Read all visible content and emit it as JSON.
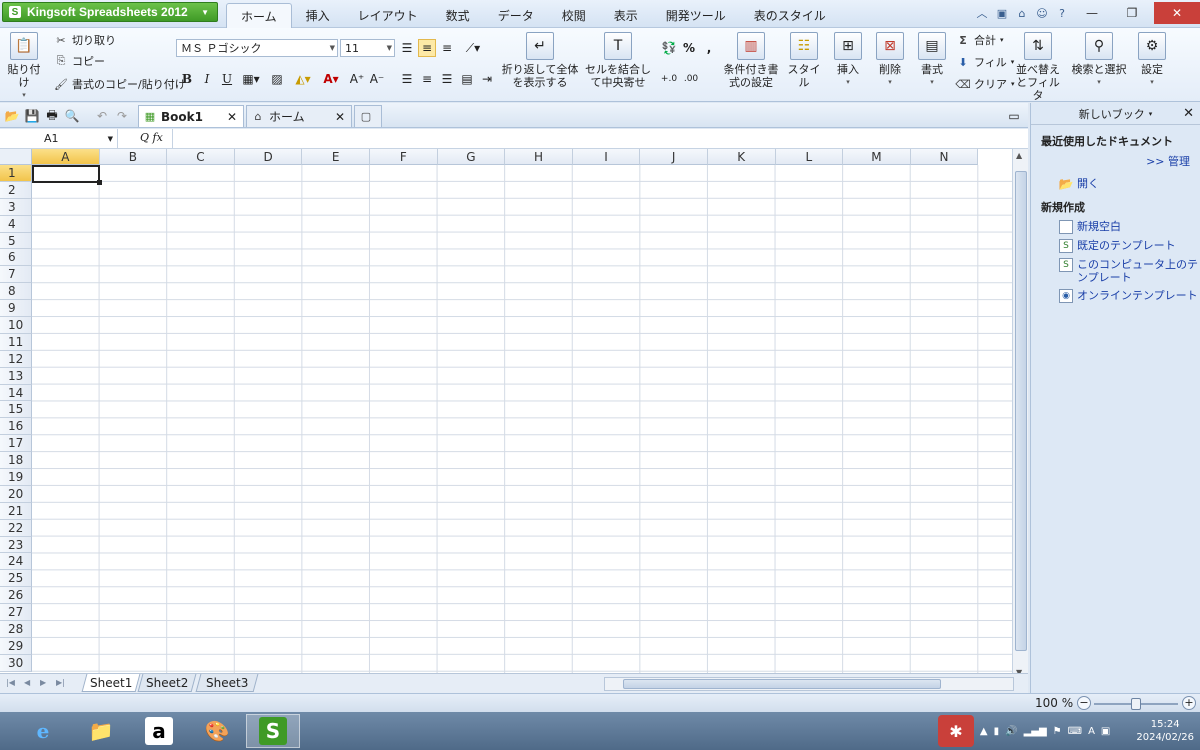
{
  "app": {
    "name": "Kingsoft Spreadsheets 2012",
    "brand_color": "#4aa52c"
  },
  "ribbon_tabs": [
    {
      "label": "ホーム",
      "active": true
    },
    {
      "label": "挿入"
    },
    {
      "label": "レイアウト"
    },
    {
      "label": "数式"
    },
    {
      "label": "データ"
    },
    {
      "label": "校閲"
    },
    {
      "label": "表示"
    },
    {
      "label": "開発ツール"
    },
    {
      "label": "表のスタイル"
    }
  ],
  "clipboard": {
    "paste": "貼り付け",
    "cut": "切り取り",
    "copy": "コピー",
    "format_painter": "書式のコピー/貼り付け"
  },
  "font": {
    "name": "ＭＳ Ｐゴシック",
    "size": "11",
    "bold": "B",
    "italic": "I",
    "underline": "U",
    "color_letter": "A",
    "grow": "A⁺",
    "shrink": "A⁻"
  },
  "ribbon_buttons": {
    "wrap": "折り返して全体を表示する",
    "merge": "セルを結合して中央寄せ",
    "percent": "%",
    "comma": ",",
    "conditional": "条件付き書式の設定",
    "styles": "スタイル",
    "insert": "挿入",
    "delete": "削除",
    "format": "書式",
    "sum": "合計",
    "fill": "フィル",
    "clear": "クリア",
    "sort_filter": "並べ替えとフィルタ",
    "find_select": "検索と選択",
    "settings": "設定"
  },
  "doc_tabs": [
    {
      "label": "Book1",
      "active": true
    },
    {
      "label": "ホーム"
    }
  ],
  "formula_bar": {
    "name_box": "A1",
    "fx": "fx",
    "value": ""
  },
  "columns": [
    "A",
    "B",
    "C",
    "D",
    "E",
    "F",
    "G",
    "H",
    "I",
    "J",
    "K",
    "L",
    "M",
    "N"
  ],
  "rows": [
    "1",
    "2",
    "3",
    "4",
    "5",
    "6",
    "7",
    "8",
    "9",
    "10",
    "11",
    "12",
    "13",
    "14",
    "15",
    "16",
    "17",
    "18",
    "19",
    "20",
    "21",
    "22",
    "23",
    "24",
    "25",
    "26",
    "27",
    "28",
    "29",
    "30"
  ],
  "active_cell": "A1",
  "sheets": [
    {
      "label": "Sheet1",
      "active": true
    },
    {
      "label": "Sheet2"
    },
    {
      "label": "Sheet3"
    }
  ],
  "status": {
    "zoom": "100 %"
  },
  "task_pane": {
    "title": "新しいブック",
    "recent_header": "最近使用したドキュメント",
    "manage": ">> 管理",
    "open": "開く",
    "new_header": "新規作成",
    "new_blank": "新規空白",
    "builtin_templates": "既定のテンプレート",
    "local_templates": "このコンピュータ上のテンプレート",
    "online_templates": "オンラインテンプレート"
  },
  "taskbar": {
    "time": "15:24",
    "date": "2024/02/26"
  }
}
